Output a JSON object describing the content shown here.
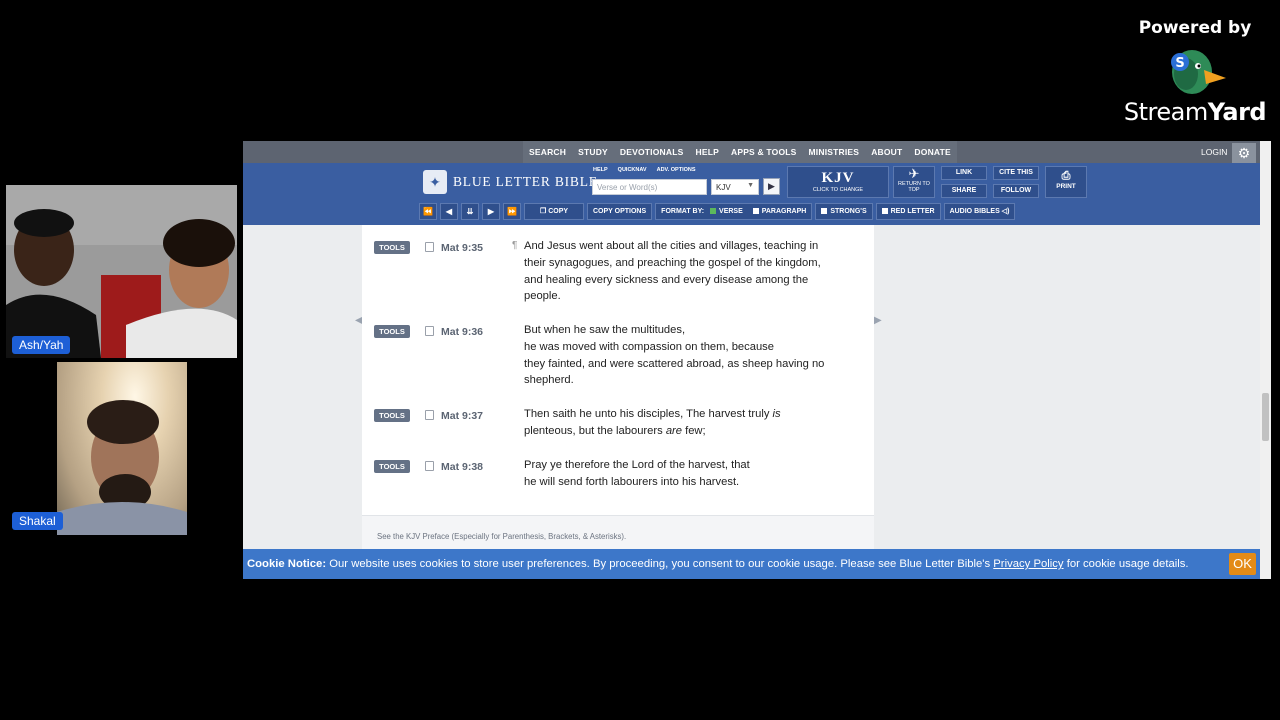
{
  "branding": {
    "powered_by": "Powered by",
    "brand_a": "Stream",
    "brand_b": "Yard"
  },
  "participants": [
    {
      "name": "Ash/Yah"
    },
    {
      "name": "Shakal"
    }
  ],
  "site": {
    "nav": [
      "SEARCH",
      "STUDY",
      "DEVOTIONALS",
      "HELP",
      "APPS & TOOLS",
      "MINISTRIES",
      "ABOUT",
      "DONATE"
    ],
    "login": "LOGIN",
    "logo_text": "BLUE LETTER BIBLE",
    "mini_links": [
      "HELP",
      "QUICKNAV",
      "ADV. OPTIONS"
    ],
    "search_placeholder": "Verse or Word(s)",
    "version": "KJV",
    "version_box": {
      "title": "KJV",
      "subtitle": "CLICK TO CHANGE"
    },
    "return_top": "RETURN TO TOP",
    "link": "LINK",
    "cite": "CITE THIS",
    "share": "SHARE",
    "follow": "FOLLOW",
    "print": "PRINT",
    "toolbar": {
      "copy": "COPY",
      "copy_options": "COPY OPTIONS",
      "format_by": "FORMAT BY:",
      "verse": "VERSE",
      "paragraph": "PARAGRAPH",
      "strongs": "STRONG'S",
      "red_letter": "RED LETTER",
      "audio": "AUDIO BIBLES"
    }
  },
  "tools_label": "TOOLS",
  "verses": [
    {
      "ref": "Mat 9:35",
      "lines": [
        "And Jesus went about all the cities and villages, teaching in",
        "their synagogues, and preaching the gospel of the kingdom,",
        "and healing every sickness and every disease among the",
        "people."
      ]
    },
    {
      "ref": "Mat 9:36",
      "lines": [
        "But when he saw the multitudes,",
        "he was moved with compassion on them, because",
        "they fainted, and were scattered abroad, as sheep having no",
        "shepherd."
      ]
    },
    {
      "ref": "Mat 9:37",
      "lines": [
        "Then saith he unto his disciples, The harvest truly is",
        "plenteous, but the labourers are few;"
      ]
    },
    {
      "ref": "Mat 9:38",
      "lines": [
        "Pray ye therefore the Lord of the harvest, that",
        "he will send forth labourers into his harvest."
      ]
    }
  ],
  "preface": "See the KJV Preface (Especially for Parenthesis, Brackets, & Asterisks).",
  "cookie": {
    "label": "Cookie Notice:",
    "text": " Our website uses cookies to store user preferences. By proceeding, you consent to our cookie usage. Please see Blue Letter Bible's ",
    "link": "Privacy Policy",
    "text2": " for cookie usage details.",
    "ok": "OK"
  }
}
